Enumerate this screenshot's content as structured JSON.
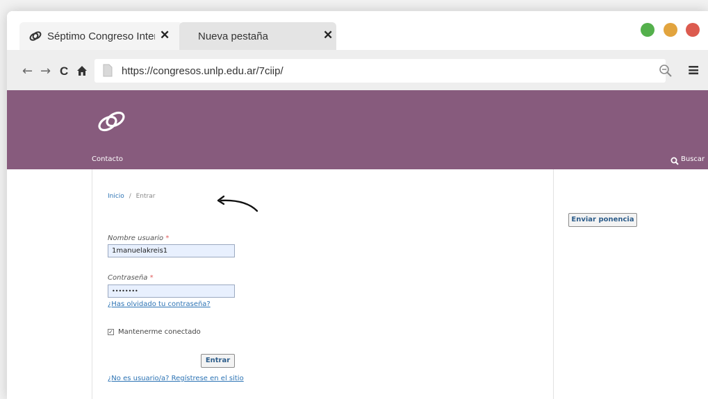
{
  "browser": {
    "tabs": [
      {
        "label": "Séptimo Congreso Intern",
        "close": "✕"
      },
      {
        "label": "Nueva pestaña",
        "close": "✕"
      }
    ],
    "window_dots": [
      "#54b04c",
      "#e2a43e",
      "#dc5b4f"
    ],
    "nav": {
      "back": "←",
      "forward": "→",
      "reload": "C",
      "home": "⌂"
    },
    "url": "https://congresos.unlp.edu.ar/7ciip/",
    "zoom_icon": "search-icon",
    "menu_icon": "≡"
  },
  "site": {
    "accent_color": "#875b7d",
    "menu": {
      "contact": "Contacto",
      "search": "Buscar"
    }
  },
  "breadcrumb": {
    "home": "Inicio",
    "separator": "/",
    "current": "Entrar"
  },
  "login": {
    "username_label": "Nombre usuario",
    "username_value": "1manuelakreis1",
    "password_label": "Contraseña",
    "password_value": "••••••••",
    "required_mark": "*",
    "forgot_link": "¿Has olvidado tu contraseña?",
    "remember_label": "Mantenerme conectado",
    "remember_checked": true,
    "submit_label": "Entrar",
    "register_link": "¿No es usuario/a? Regístrese en el sitio"
  },
  "sidebar": {
    "submit_paper": "Enviar ponencia"
  }
}
